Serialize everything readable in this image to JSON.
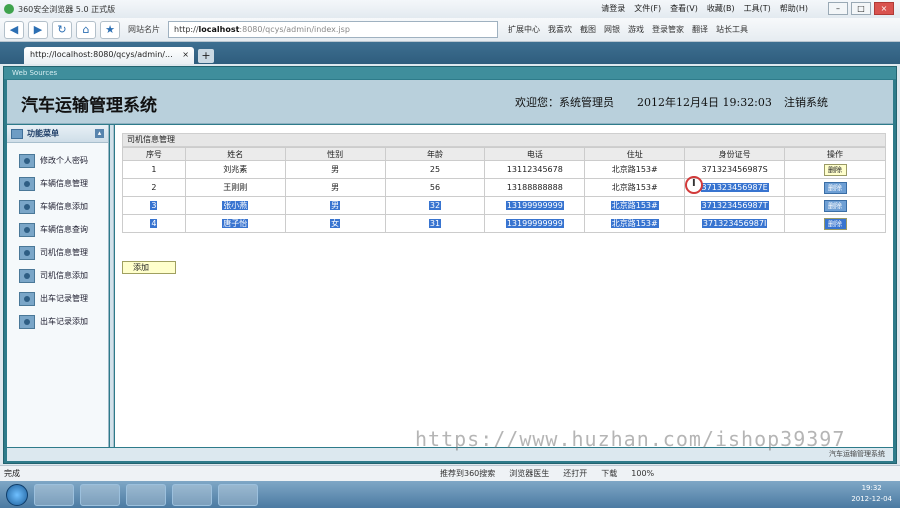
{
  "browser": {
    "title": "360安全浏览器 5.0 正式版",
    "menus": [
      "文件(F)",
      "查看(V)",
      "收藏(B)",
      "工具(T)",
      "帮助(H)"
    ],
    "login_label": "请登录",
    "site_label": "网站名片",
    "address_prefix": "http://",
    "address_host": "localhost",
    "address_path": ":8080/qcys/admin/index.jsp",
    "tools": [
      "扩展中心",
      "我喜欢",
      "截图",
      "网银",
      "游戏",
      "登录管家",
      "翻译",
      "站长工具"
    ],
    "tab_title": "http://localhost:8080/qcys/admin/...",
    "status_done": "完成",
    "status_items": [
      "推荐到360搜索",
      "浏览器医生",
      "还打开",
      "下载",
      "100%"
    ]
  },
  "app": {
    "frame_title": "Web Sources",
    "system_title": "汽车运输管理系统",
    "welcome": "欢迎您：系统管理员",
    "datetime": "2012年12月4日  19:32:03",
    "logout": "注销系统",
    "footer": "汽车运输管理系统"
  },
  "sidebar": {
    "title": "功能菜单",
    "items": [
      {
        "label": "修改个人密码"
      },
      {
        "label": "车辆信息管理"
      },
      {
        "label": "车辆信息添加"
      },
      {
        "label": "车辆信息查询"
      },
      {
        "label": "司机信息管理"
      },
      {
        "label": "司机信息添加"
      },
      {
        "label": "出车记录管理"
      },
      {
        "label": "出车记录添加"
      }
    ]
  },
  "panel": {
    "title": "司机信息管理",
    "columns": [
      "序号",
      "姓名",
      "性别",
      "年龄",
      "电话",
      "住址",
      "身份证号",
      "操作"
    ],
    "rows": [
      {
        "no": "1",
        "name": "刘兆素",
        "gender": "男",
        "age": "25",
        "phone": "13112345678",
        "address": "北京路153#",
        "id_card": "371323456987S",
        "action": "删除"
      },
      {
        "no": "2",
        "name": "王刚刚",
        "gender": "男",
        "age": "56",
        "phone": "13188888888",
        "address": "北京路153#",
        "id_card": "371323456987E",
        "action": "删除"
      },
      {
        "no": "3",
        "name": "张小燕",
        "gender": "男",
        "age": "32",
        "phone": "13199999999",
        "address": "北京路153#",
        "id_card": "371323456987T",
        "action": "删除"
      },
      {
        "no": "4",
        "name": "唐子怡",
        "gender": "女",
        "age": "31",
        "phone": "13199999999",
        "address": "北京路153#",
        "id_card": "371323456987I",
        "action": "删除"
      }
    ],
    "add_label": "添加"
  },
  "watermark": "https://www.huzhan.com/ishop39397",
  "clock": {
    "time": "19:32",
    "date": "2012-12-04"
  }
}
